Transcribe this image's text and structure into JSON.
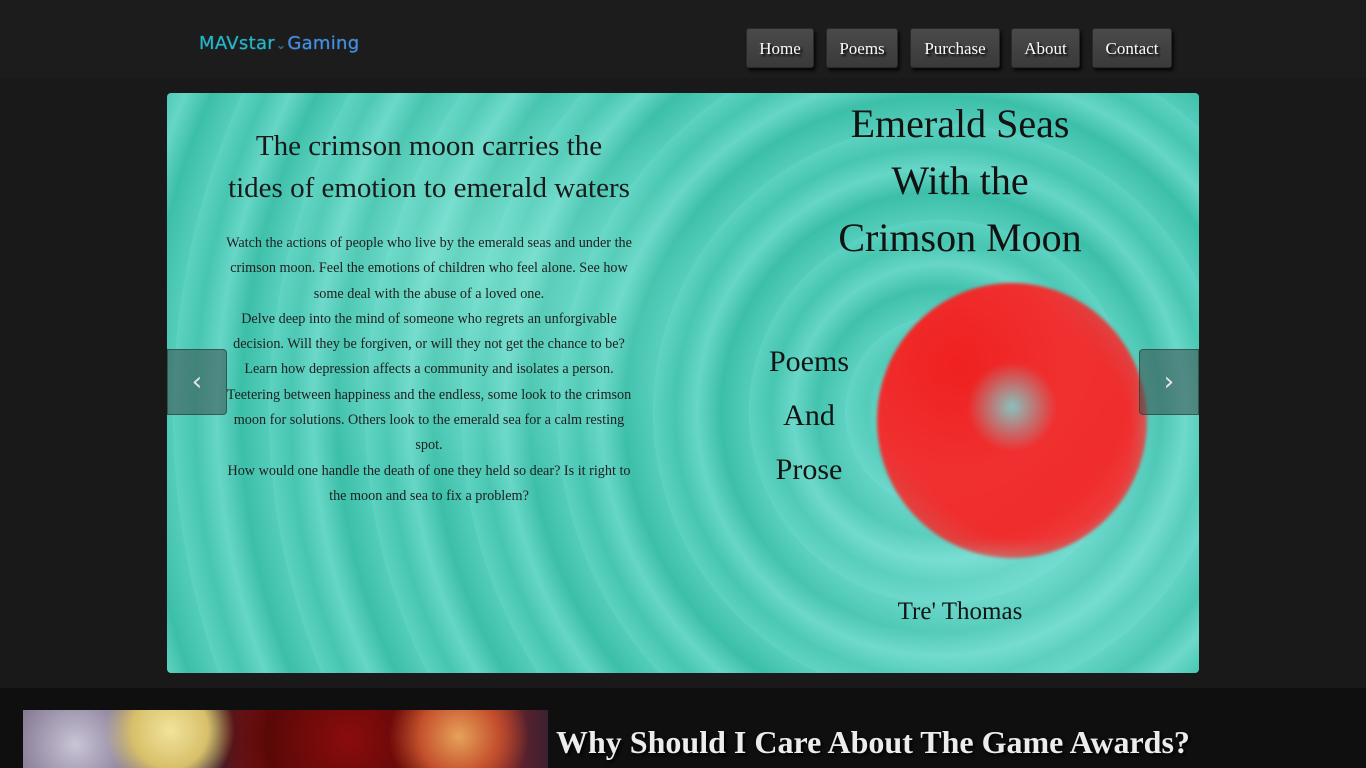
{
  "site": {
    "logo_part1": "MAVstar",
    "logo_part2": "Gaming"
  },
  "nav": {
    "items": [
      {
        "label": "Home"
      },
      {
        "label": "Poems"
      },
      {
        "label": "Purchase"
      },
      {
        "label": "About"
      },
      {
        "label": "Contact"
      }
    ]
  },
  "carousel": {
    "prev_icon": "chevron-left-icon",
    "next_icon": "chevron-right-icon",
    "slide": {
      "tagline_line1": "The crimson moon carries the",
      "tagline_line2": "tides of emotion to emerald waters",
      "blurb": [
        "Watch the actions of people who live by the emerald seas and under the crimson moon. Feel the emotions of children who feel alone. See how some deal with the abuse of a loved one.",
        "Delve deep into the mind of someone who regrets an unforgivable decision. Will they be forgiven, or will they not get the chance to be?",
        "Learn how depression affects a community and isolates a person.",
        "Teetering between happiness and the endless, some look to the crimson moon for solutions. Others look to the emerald sea for a calm resting spot.",
        "How would one handle the death of one they held so dear? Is it right to the moon and sea to fix a problem?"
      ],
      "book_title": [
        "Emerald Seas",
        "With the",
        "Crimson Moon"
      ],
      "sub_title": [
        "Poems",
        "And",
        "Prose"
      ],
      "author": "Tre' Thomas",
      "colors": {
        "sea": "#4cc9b6",
        "moon": "#f02020"
      }
    }
  },
  "article": {
    "title": "Why Should I Care About The Game Awards?"
  }
}
